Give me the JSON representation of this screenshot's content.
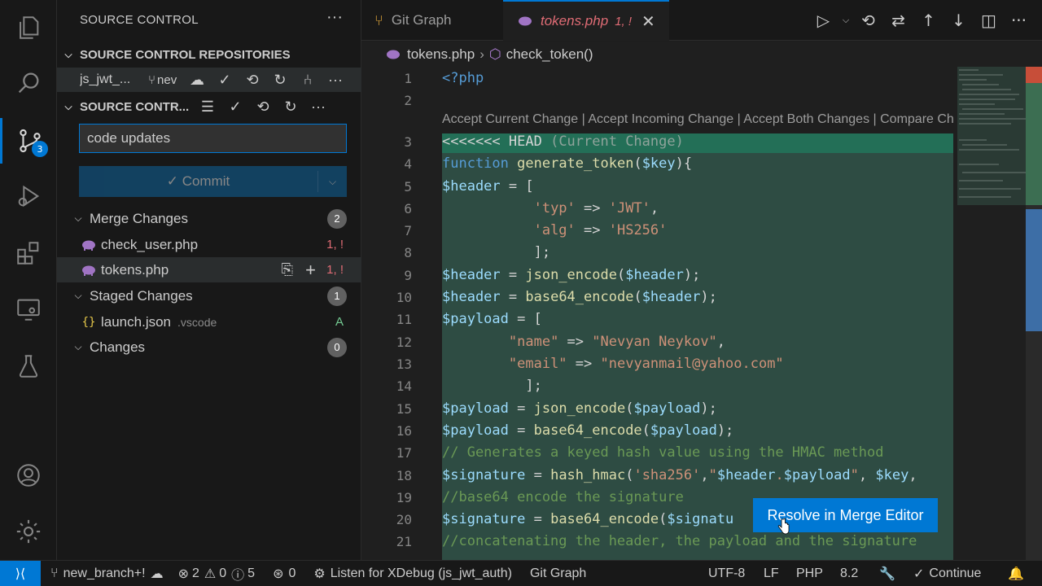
{
  "sidebar": {
    "title": "SOURCE CONTROL",
    "repos_header": "SOURCE CONTROL REPOSITORIES",
    "repo": {
      "name": "js_jwt_...",
      "branch": "nev"
    },
    "sc_header": "SOURCE CONTR...",
    "commit_message": "code updates",
    "commit_label": "✓ Commit",
    "groups": [
      {
        "label": "Merge Changes",
        "count": "2"
      },
      {
        "label": "Staged Changes",
        "count": "1"
      },
      {
        "label": "Changes",
        "count": "0"
      }
    ],
    "merge_files": [
      {
        "name": "check_user.php",
        "status": "1, !"
      },
      {
        "name": "tokens.php",
        "status": "1, !"
      }
    ],
    "staged_files": [
      {
        "name": "launch.json",
        "folder": ".vscode",
        "status": "A"
      }
    ],
    "scm_badge": "3"
  },
  "tabs": [
    {
      "label": "Git Graph"
    },
    {
      "label": "tokens.php",
      "suffix": "1, !"
    }
  ],
  "breadcrumb": {
    "file": "tokens.php",
    "symbol": "check_token()"
  },
  "editor": {
    "codelens": "Accept Current Change | Accept Incoming Change | Accept Both Changes | Compare Changes",
    "line_numbers": [
      "1",
      "2",
      "3",
      "4",
      "5",
      "6",
      "7",
      "8",
      "9",
      "10",
      "11",
      "12",
      "13",
      "14",
      "15",
      "16",
      "17",
      "18",
      "19",
      "20",
      "21"
    ],
    "resolve_button": "Resolve in Merge Editor"
  },
  "statusbar": {
    "branch": "new_branch+!",
    "errors": "2",
    "warnings": "0",
    "info": "5",
    "ports": "0",
    "xdebug": "Listen for XDebug (js_jwt_auth)",
    "gitgraph": "Git Graph",
    "encoding": "UTF-8",
    "eol": "LF",
    "language": "PHP",
    "version": "8.2",
    "continue": "Continue"
  },
  "colors": {
    "accent": "#0078d4",
    "current_change": "#236f57",
    "conflict_block": "#2e4c43"
  }
}
